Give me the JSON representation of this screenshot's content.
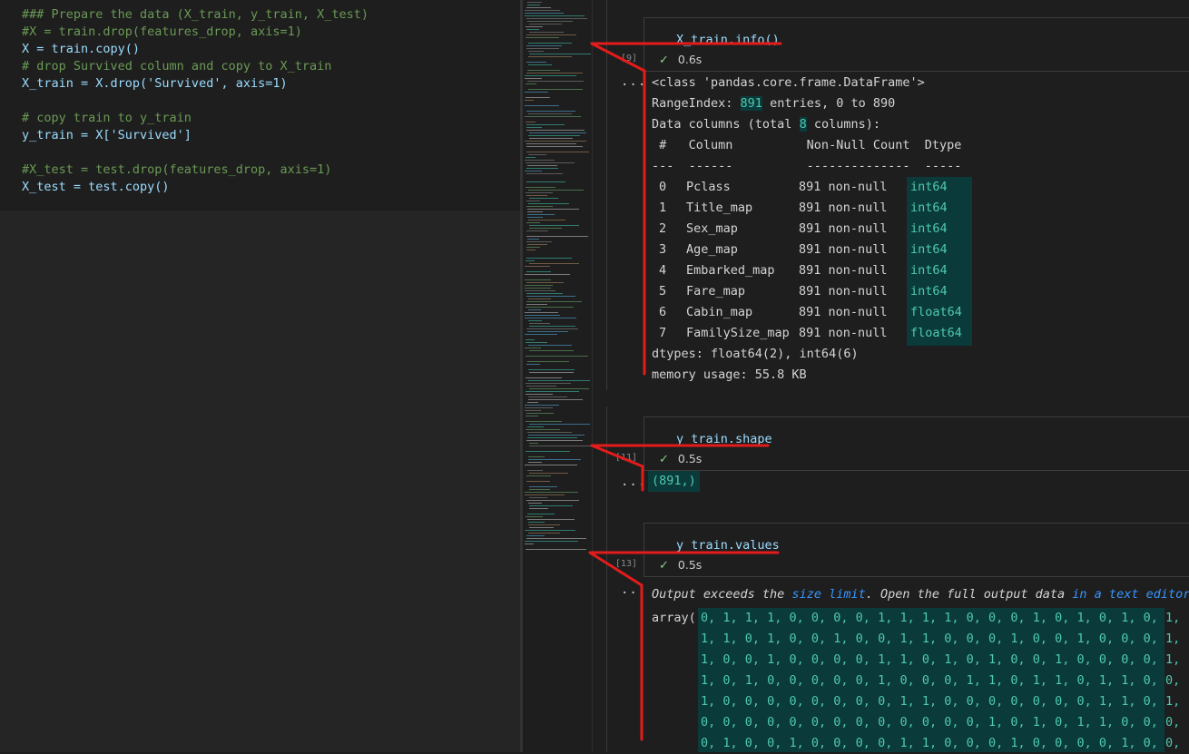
{
  "editor": {
    "lines": [
      {
        "text": "### Prepare the data (X_train, y_train, X_test)",
        "kind": "comment"
      },
      {
        "text": "#X = train.drop(features_drop, axis=1)",
        "kind": "comment"
      },
      {
        "text": "X = train.copy()",
        "kind": "code"
      },
      {
        "text": "# drop Survived column and copy to X_train",
        "kind": "comment"
      },
      {
        "text": "X_train = X.drop('Survived', axis=1)",
        "kind": "code"
      },
      {
        "text": "",
        "kind": "blank"
      },
      {
        "text": "# copy train to y_train",
        "kind": "comment"
      },
      {
        "text": "y_train = X['Survived']",
        "kind": "code"
      },
      {
        "text": "",
        "kind": "blank"
      },
      {
        "text": "#X_test = test.drop(features_drop, axis=1)",
        "kind": "comment"
      },
      {
        "text": "X_test = test.copy()",
        "kind": "code"
      }
    ]
  },
  "cells": [
    {
      "code": "X_train.info()",
      "exec_count": "[9]",
      "status": "0.6s",
      "output": {
        "header": [
          "<class 'pandas.core.frame.DataFrame'>"
        ],
        "range_index": {
          "prefix": "RangeIndex: ",
          "num": "891",
          "suffix": " entries, 0 to 890"
        },
        "data_columns": {
          "prefix": "Data columns (total ",
          "num": "8",
          "suffix": " columns):"
        },
        "table_header": " #   Column          Non-Null Count  Dtype",
        "table_sep": "---  ------          --------------  -----",
        "rows": [
          {
            "idx": "0",
            "col": "Pclass",
            "nonnull": "891 non-null",
            "dtype": "int64"
          },
          {
            "idx": "1",
            "col": "Title_map",
            "nonnull": "891 non-null",
            "dtype": "int64"
          },
          {
            "idx": "2",
            "col": "Sex_map",
            "nonnull": "891 non-null",
            "dtype": "int64"
          },
          {
            "idx": "3",
            "col": "Age_map",
            "nonnull": "891 non-null",
            "dtype": "int64"
          },
          {
            "idx": "4",
            "col": "Embarked_map",
            "nonnull": "891 non-null",
            "dtype": "int64"
          },
          {
            "idx": "5",
            "col": "Fare_map",
            "nonnull": "891 non-null",
            "dtype": "int64"
          },
          {
            "idx": "6",
            "col": "Cabin_map",
            "nonnull": "891 non-null",
            "dtype": "float64"
          },
          {
            "idx": "7",
            "col": "FamilySize_map",
            "nonnull": "891 non-null",
            "dtype": "float64"
          }
        ],
        "dtypes": "dtypes: float64(2), int64(6)",
        "memory": "memory usage: 55.8 KB"
      }
    },
    {
      "code": "y_train.shape",
      "exec_count": "[11]",
      "status": "0.5s",
      "output": {
        "text": "(891,)"
      }
    },
    {
      "code": "y_train.values",
      "exec_count": "[13]",
      "status": "0.5s",
      "output": {
        "notice_prefix": "Output exceeds the ",
        "notice_link1": "size limit",
        "notice_mid": ". Open the full output data ",
        "notice_link2": "in a text editor",
        "array_prefix": "array([",
        "array_lines": [
          "0, 1, 1, 1, 0, 0, 0, 0, 1, 1, 1, 1, 0, 0, 0, 1, 0, 1, 0, 1, 0, 1,",
          "1, 1, 0, 1, 0, 0, 1, 0, 0, 1, 1, 0, 0, 0, 1, 0, 0, 1, 0, 0, 0, 1,",
          "1, 0, 0, 1, 0, 0, 0, 0, 1, 1, 0, 1, 0, 1, 0, 0, 1, 0, 0, 0, 0, 1,",
          "1, 0, 1, 0, 0, 0, 0, 0, 1, 0, 0, 0, 1, 1, 0, 1, 1, 0, 1, 1, 0, 0,",
          "1, 0, 0, 0, 0, 0, 0, 0, 0, 1, 1, 0, 0, 0, 0, 0, 0, 0, 1, 1, 0, 1,",
          "0, 0, 0, 0, 0, 0, 0, 0, 0, 0, 0, 0, 0, 1, 0, 1, 0, 1, 1, 0, 0, 0,",
          "0, 1, 0, 0, 1, 0, 0, 0, 0, 1, 1, 0, 0, 0, 1, 0, 0, 0, 0, 1, 0, 0,"
        ]
      }
    }
  ],
  "ui": {
    "ellipsis": "...",
    "check_glyph": "✓"
  },
  "colors": {
    "annotation_red": "#e41b1b",
    "highlight_teal": "#4ec9b0",
    "link_blue": "#3794ff"
  }
}
